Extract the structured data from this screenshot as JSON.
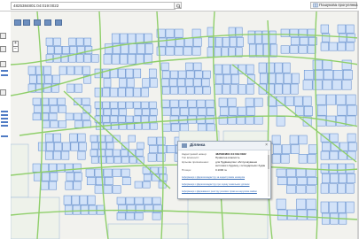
{
  "search": {
    "value": "4825384801:04:019:0022"
  },
  "toolbar": {
    "cadastre_label": "Пошукова прогулянка"
  },
  "popup": {
    "title": "Ділянка",
    "close": "×",
    "rows": [
      {
        "label": "Кадастровий номер:",
        "value": "4825384801:04:019:0022"
      },
      {
        "label": "Тип власності:",
        "value": "Приватна власність"
      },
      {
        "label": "Цільове призначення:",
        "value": "для будівництва і обслуговування"
      },
      {
        "label": "",
        "value": "житлового будинку, господарських будівель і споруд"
      },
      {
        "label": "Площа:",
        "value": "0.1000 га"
      }
    ],
    "links": [
      "Інформація з Держгеокадастру за кадастровим номером",
      "Інформація з Держгеокадастру про оцінку земельних ділянок",
      "Інформація з Державного реєстру речових прав на нерухоме майно"
    ]
  },
  "zoom": {
    "in": "+",
    "out": "−"
  },
  "colors": {
    "parcel_fill": "#d2e2f8",
    "parcel_stroke": "#5686cc",
    "road": "#8fcf6a",
    "map_bg": "#f2f2ee",
    "topbar_bg": "#ffffff"
  },
  "icons": {
    "search": "magnifier-icon",
    "cadastre": "map-icon",
    "popup_logo": "land-parcel-icon",
    "close": "close-icon"
  }
}
